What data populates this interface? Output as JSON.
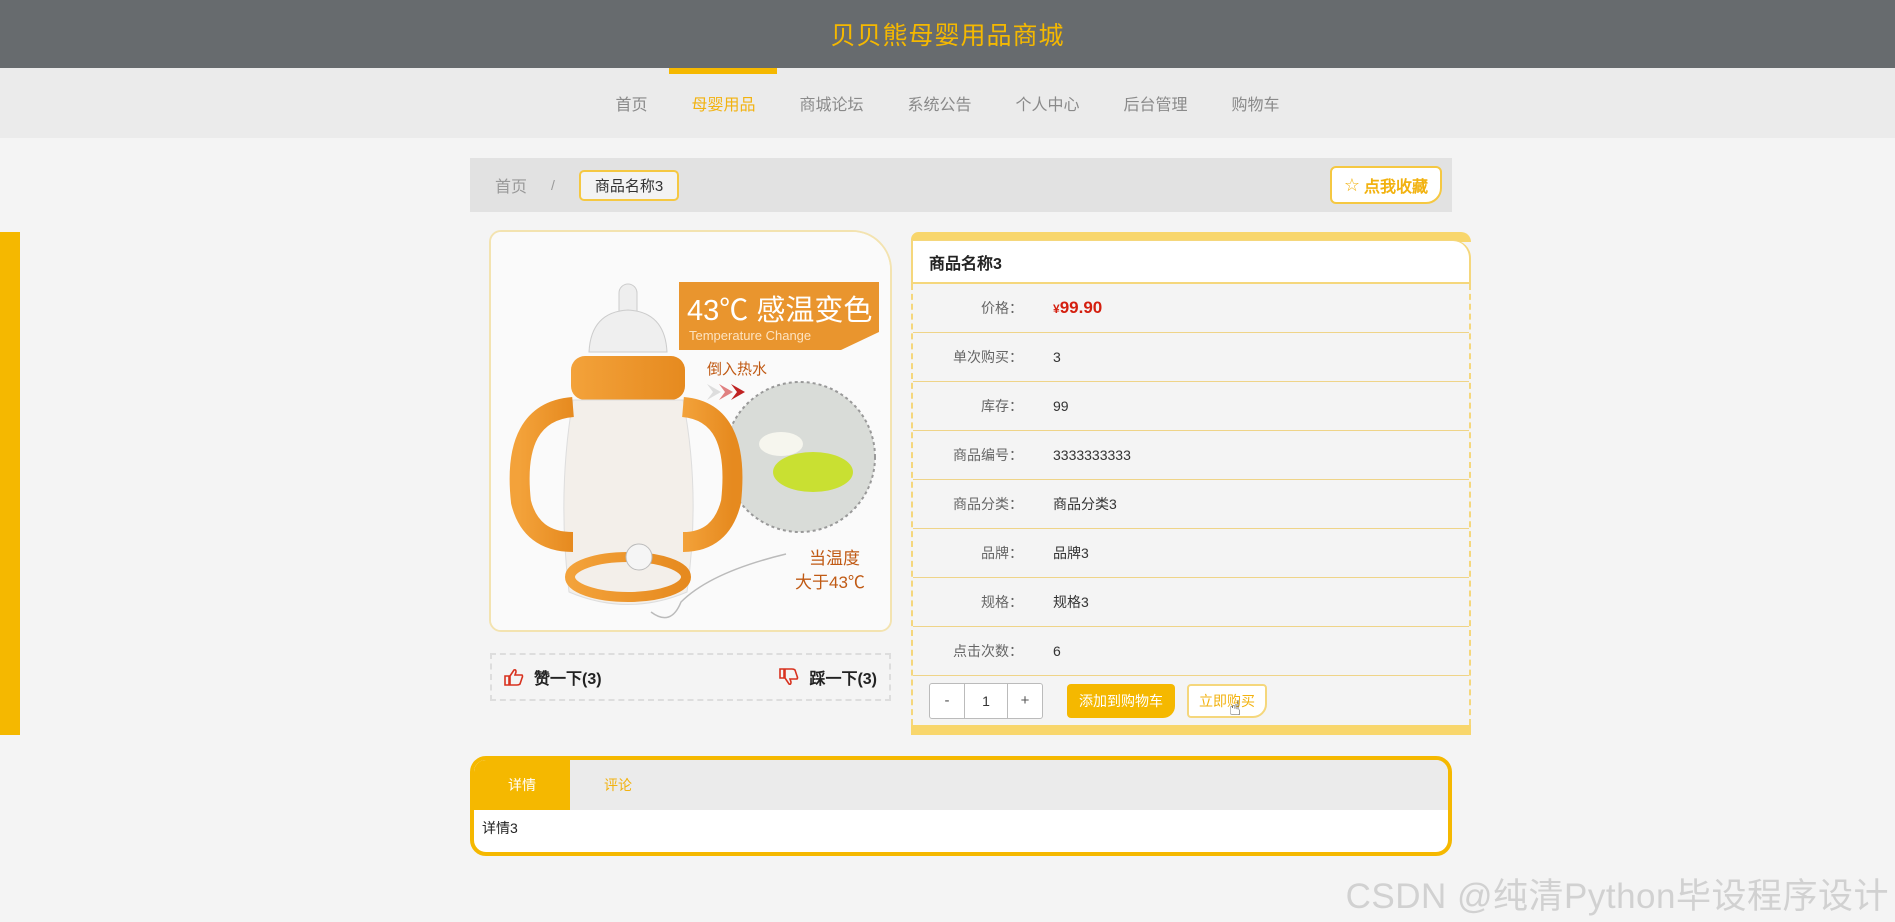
{
  "header": {
    "site_title": "贝贝熊母婴用品商城"
  },
  "nav": {
    "items": [
      {
        "label": "首页",
        "active": false
      },
      {
        "label": "母婴用品",
        "active": true
      },
      {
        "label": "商城论坛",
        "active": false
      },
      {
        "label": "系统公告",
        "active": false
      },
      {
        "label": "个人中心",
        "active": false
      },
      {
        "label": "后台管理",
        "active": false
      },
      {
        "label": "购物车",
        "active": false
      }
    ]
  },
  "breadcrumb": {
    "home": "首页",
    "separator": "/",
    "current": "商品名称3"
  },
  "favorite": {
    "label": "点我收藏",
    "icon": "star-outline-icon"
  },
  "product_image": {
    "headline": "43℃ 感温变色",
    "subhead": "Temperature Change",
    "pour_text": "倒入热水",
    "temp_text_1": "当温度",
    "temp_text_2": "大于43℃"
  },
  "votes": {
    "like_label": "赞一下(3)",
    "like_icon": "thumbs-up-icon",
    "dislike_label": "踩一下(3)",
    "dislike_icon": "thumbs-down-icon"
  },
  "product": {
    "name": "商品名称3",
    "rows": [
      {
        "label": "价格：",
        "currency": "¥",
        "value": "99.90"
      },
      {
        "label": "单次购买：",
        "value": "3"
      },
      {
        "label": "库存：",
        "value": "99"
      },
      {
        "label": "商品编号：",
        "value": "3333333333"
      },
      {
        "label": "商品分类：",
        "value": "商品分类3"
      },
      {
        "label": "品牌：",
        "value": "品牌3"
      },
      {
        "label": "规格：",
        "value": "规格3"
      },
      {
        "label": "点击次数：",
        "value": "6"
      }
    ]
  },
  "purchase": {
    "minus": "-",
    "quantity": "1",
    "plus": "+",
    "add_to_cart": "添加到购物车",
    "buy_now": "立即购买"
  },
  "tabs": {
    "items": [
      {
        "label": "详情",
        "active": true
      },
      {
        "label": "评论",
        "active": false
      }
    ],
    "content": "详情3"
  },
  "watermark": "CSDN @纯清Python毕设程序设计",
  "colors": {
    "accent": "#f5b800",
    "header_bg": "#676b6e",
    "price": "#d41f0f"
  }
}
